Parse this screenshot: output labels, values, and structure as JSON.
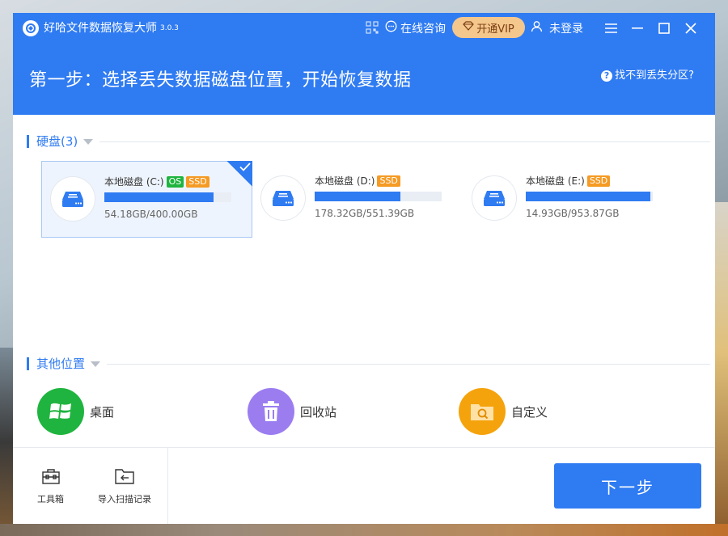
{
  "app": {
    "title": "好哈文件数据恢复大师",
    "version": "3.0.3",
    "consult_label": "在线咨询",
    "vip_label": "开通VIP",
    "login_label": "未登录"
  },
  "header": {
    "step_title": "第一步：选择丢失数据磁盘位置，开始恢复数据",
    "help_link": "找不到丢失分区?"
  },
  "disks_section": {
    "title": "硬盘(3)",
    "disks": [
      {
        "name": "本地磁盘 (C:)",
        "tags": [
          "OS",
          "SSD"
        ],
        "size": "54.18GB/400.00GB",
        "used_fraction": 0.86,
        "selected": true
      },
      {
        "name": "本地磁盘 (D:)",
        "tags": [
          "SSD"
        ],
        "size": "178.32GB/551.39GB",
        "used_fraction": 0.676,
        "selected": false
      },
      {
        "name": "本地磁盘 (E:)",
        "tags": [
          "SSD"
        ],
        "size": "14.93GB/953.87GB",
        "used_fraction": 0.984,
        "selected": false
      }
    ]
  },
  "other_section": {
    "title": "其他位置",
    "items": [
      {
        "label": "桌面",
        "icon": "windows-icon",
        "color": "#1fb43f"
      },
      {
        "label": "回收站",
        "icon": "recycle-bin-icon",
        "color": "#9b7df0"
      },
      {
        "label": "自定义",
        "icon": "folder-search-icon",
        "color": "#f5a30c"
      }
    ]
  },
  "footer": {
    "toolbox_label": "工具箱",
    "import_label": "导入扫描记录",
    "next_button": "下一步"
  },
  "colors": {
    "primary": "#2f7bf2",
    "os_tag": "#1fb43f",
    "ssd_tag": "#f59a23",
    "vip_bg": "#f4c78d"
  }
}
